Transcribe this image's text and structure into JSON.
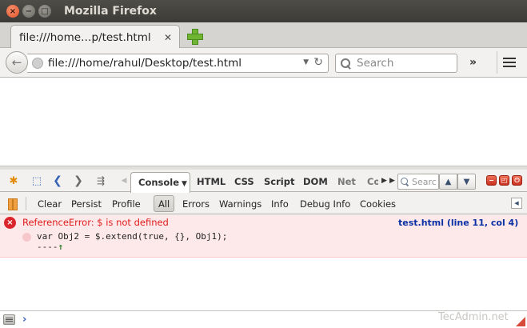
{
  "window": {
    "title": "Mozilla Firefox",
    "close_glyph": "×",
    "min_glyph": "−",
    "max_glyph": "□"
  },
  "tab": {
    "label": "file:///home…p/test.html",
    "close_glyph": "✕"
  },
  "navbar": {
    "back_glyph": "←",
    "url": "file:///home/rahul/Desktop/test.html",
    "dropdown_glyph": "▼",
    "reload_glyph": "↻",
    "search_placeholder": "Search",
    "overflow_glyph": "»"
  },
  "firebug": {
    "tools": {
      "bug_glyph": "✱",
      "inspect_glyph": "⬚",
      "back_glyph": "❮",
      "forward_glyph": "❯",
      "list_glyph": "⇶",
      "tab_prev_glyph": "◀",
      "tab_next_glyph": "▶",
      "tab_list_glyph": "▶"
    },
    "tabs": [
      "Console",
      "HTML",
      "CSS",
      "Script",
      "DOM",
      "Net",
      "Co"
    ],
    "active_tab_caret": "▼",
    "search_placeholder": "Searc",
    "up_glyph": "▲",
    "down_glyph": "▼",
    "min_glyph": "−",
    "detach_glyph": "◰",
    "close_glyph": "⏻",
    "filters": [
      "Clear",
      "Persist",
      "Profile",
      "All",
      "Errors",
      "Warnings",
      "Info",
      "Debug Info",
      "Cookies"
    ],
    "active_filter": "All",
    "collapse_glyph": "◀"
  },
  "console": {
    "error": {
      "icon_glyph": "×",
      "message": "ReferenceError: $ is not defined",
      "source": "test.html (line 11, col 4)",
      "code": "var Obj2 = $.extend(true, {}, Obj1);",
      "caret_prefix": "----",
      "caret_glyph": "↑"
    },
    "prompt_glyph": "›"
  },
  "watermark": "TecAdmin.net",
  "colors": {
    "accent": "#3663b5",
    "error_red": "#e01c1c",
    "error_bg": "#fde9ea",
    "source_link": "#0a31a4"
  }
}
